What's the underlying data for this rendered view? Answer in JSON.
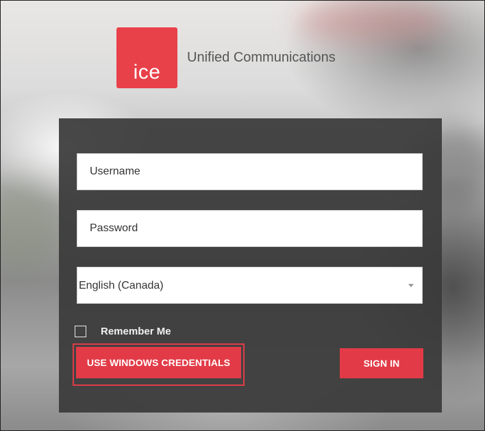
{
  "logo": {
    "text": "ice",
    "color": "#e8414a"
  },
  "app_title": "Unified Communications",
  "login": {
    "username_placeholder": "Username",
    "password_placeholder": "Password",
    "language_selected": "English (Canada)",
    "remember_label": "Remember Me",
    "remember_checked": false,
    "windows_button_label": "USE WINDOWS CREDENTIALS",
    "signin_button_label": "SIGN IN"
  },
  "colors": {
    "accent": "#e23b47",
    "panel": "#3a3a3a"
  }
}
